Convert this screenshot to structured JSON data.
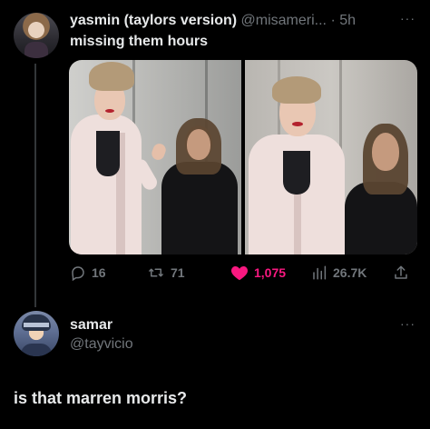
{
  "tweet": {
    "display_name": "yasmin (taylors version)",
    "handle": "@misameri...",
    "separator": "·",
    "time": "5h",
    "more": "···",
    "text": "missing them hours",
    "stats": {
      "replies": "16",
      "retweets": "71",
      "likes": "1,075",
      "views": "26.7K"
    },
    "colors": {
      "like_active": "#f91880",
      "muted": "#71767b"
    },
    "icons": [
      "reply-icon",
      "retweet-icon",
      "heart-icon",
      "views-icon",
      "share-icon"
    ]
  },
  "reply": {
    "display_name": "samar",
    "handle": "@tayvicio",
    "more": "···",
    "text": "is that marren morris?"
  }
}
